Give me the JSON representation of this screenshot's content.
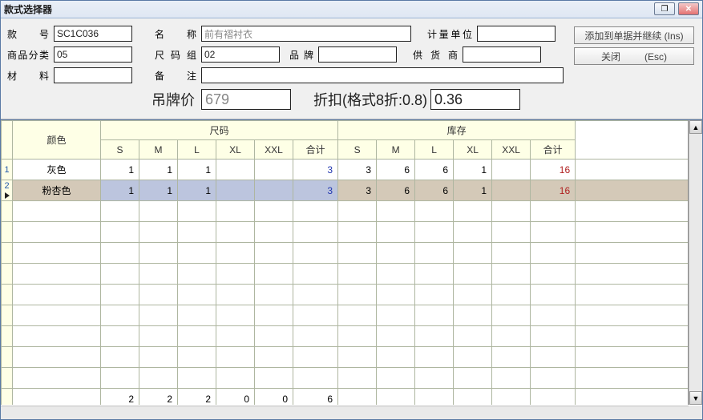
{
  "window": {
    "title": "款式选择器",
    "restore_glyph": "❐",
    "close_glyph": "✕"
  },
  "form": {
    "style_no_label": "款    号",
    "style_no": "SC1C036",
    "name_label": "名    称",
    "name": "前有褶衬衣",
    "unit_label": "计量单位",
    "unit": "",
    "category_label": "商品分类",
    "category": "05",
    "sizegrp_label": "尺码组",
    "sizegrp": "02",
    "brand_label": "品牌",
    "brand": "",
    "supplier_label": "供 货 商",
    "supplier": "",
    "material_label": "材    料",
    "material": "",
    "remark_label": "备    注",
    "remark": ""
  },
  "price": {
    "tag_label": "吊牌价",
    "tag_value": "679",
    "discount_label": "折扣(格式8折:0.8)",
    "discount_value": "0.36"
  },
  "buttons": {
    "add_continue": "添加到单据并继续 (Ins)",
    "close": "关闭         (Esc)"
  },
  "grid": {
    "header_color": "颜色",
    "header_size": "尺码",
    "header_stock": "库存",
    "sizes": [
      "S",
      "M",
      "L",
      "XL",
      "XXL"
    ],
    "total_label": "合计",
    "rows": [
      {
        "idx": "1",
        "color": "灰色",
        "size_vals": [
          "1",
          "1",
          "1",
          "",
          ""
        ],
        "size_total": "3",
        "stock_vals": [
          "3",
          "6",
          "6",
          "1",
          ""
        ],
        "stock_total": "16",
        "selected": false
      },
      {
        "idx": "2",
        "color": "粉杏色",
        "size_vals": [
          "1",
          "1",
          "1",
          "",
          ""
        ],
        "size_total": "3",
        "stock_vals": [
          "3",
          "6",
          "6",
          "1",
          ""
        ],
        "stock_total": "16",
        "selected": true
      }
    ],
    "footer": {
      "size_vals": [
        "2",
        "2",
        "2",
        "0",
        "0"
      ],
      "size_total": "6",
      "stock_vals": [
        "",
        "",
        "",
        "",
        ""
      ],
      "stock_total": ""
    }
  }
}
